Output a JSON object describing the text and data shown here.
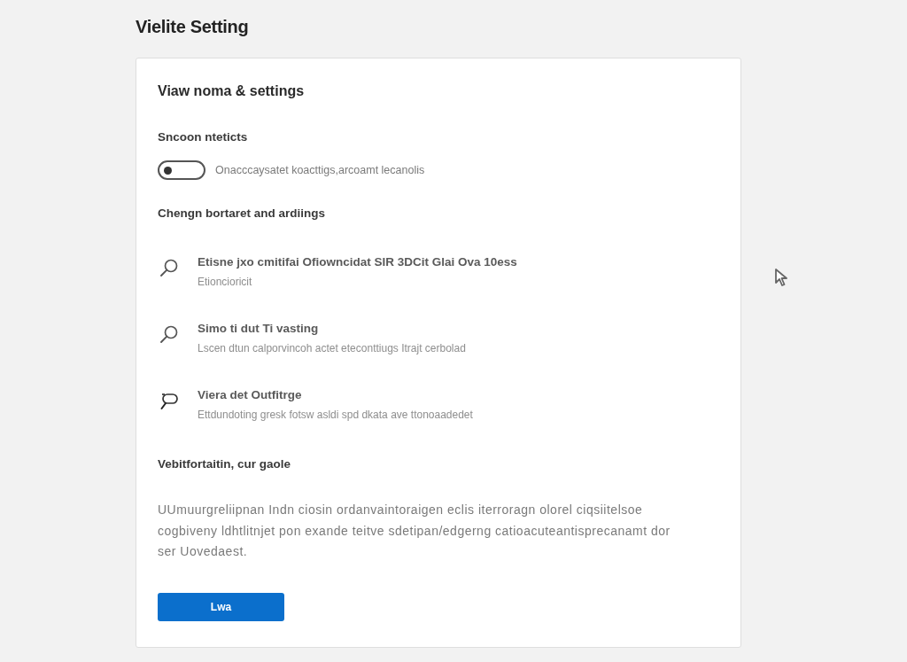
{
  "page_title": "Vielite Setting",
  "panel": {
    "heading": "Viaw noma & settings",
    "sections": [
      {
        "kind": "toggle",
        "label": "Sncoon nteticts",
        "toggle": {
          "on": false,
          "label": "Onacccaysatet koacttigs,arcoamt lecanolis"
        }
      },
      {
        "kind": "list",
        "label": "Chengn bortaret and ardiings",
        "items": [
          {
            "kind": "search",
            "title": "Etisne jxo cmitifai Ofiowncidat SIR 3DCit Glai Ova 10ess",
            "subtitle": "Etioncioricit"
          },
          {
            "kind": "search",
            "title": "Simo ti dut Ti vasting",
            "subtitle": "Lscen dtun calporvincoh actet eteconttiugs Itrajt cerbolad"
          },
          {
            "kind": "inspect",
            "title": "Viera det Outfitrge",
            "subtitle": "Ettdundoting gresk fotsw asldi spd dkata ave ttonoaadedet"
          }
        ]
      },
      {
        "kind": "text",
        "label": "Vebitfortaitin, cur gaole",
        "text": "UUmuurgreliipnan Indn ciosin ordanvaintoraigen eclis iterroragn olorel ciqsiitelsoe cogbiveny ldhtlitnjet pon exande teitve sdetipan/edgerng catioacuteantisprecanamt dor ser Uovedaest.",
        "button": "Lwa"
      }
    ]
  }
}
